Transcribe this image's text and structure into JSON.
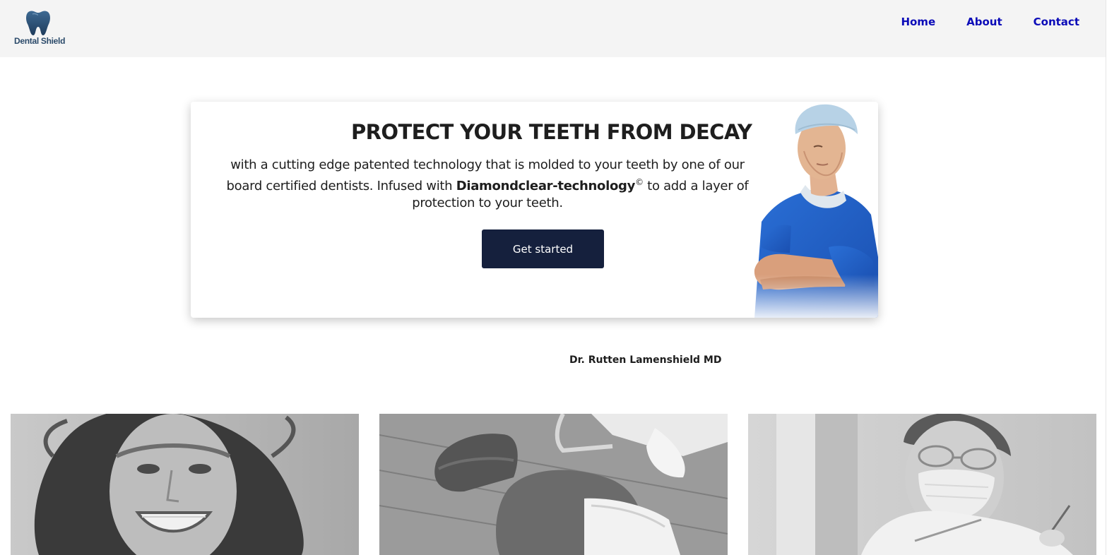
{
  "header": {
    "logo_text": "Dental Shield",
    "logo_icon": "tooth-icon",
    "nav": [
      {
        "label": "Home"
      },
      {
        "label": "About"
      },
      {
        "label": "Contact"
      }
    ]
  },
  "hero": {
    "title": "PROTECT YOUR TEETH FROM DECAY",
    "text_before": "with a cutting edge patented technology that is molded to your teeth by one of our board certified dentists. Infused with ",
    "text_bold": "Diamondclear-technology",
    "text_sup": "©",
    "text_after": " to add a layer of protection to your teeth.",
    "cta_label": "Get started"
  },
  "doctor_caption": "Dr. Rutten Lamenshield MD",
  "colors": {
    "header_bg": "#f4f4f4",
    "nav_link": "#0b0bb8",
    "cta_bg": "#15203d",
    "logo": "#2b4a6a",
    "scrubs": "#1f5fc9"
  }
}
